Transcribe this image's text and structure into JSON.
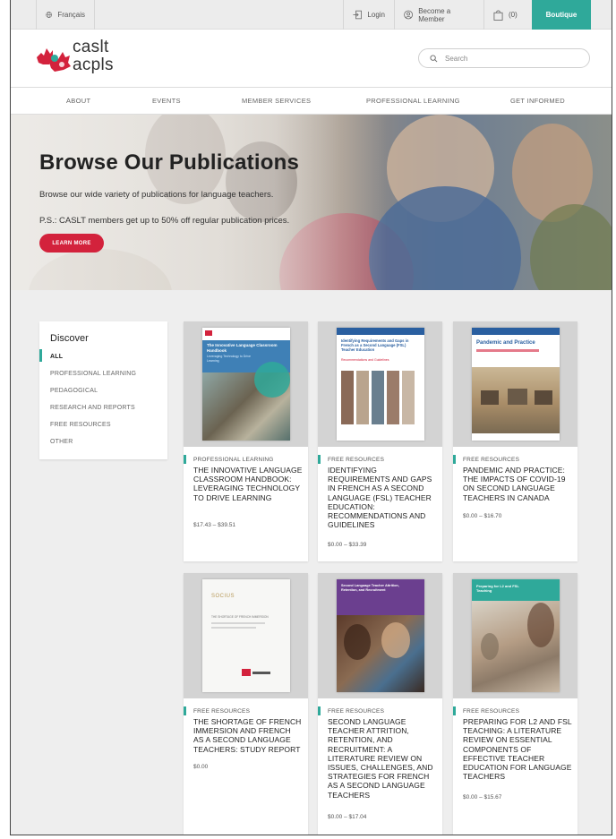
{
  "topbar": {
    "language": "Français",
    "login": "Login",
    "become_member": "Become a Member",
    "cart_count": "(0)",
    "boutique": "Boutique"
  },
  "logo": {
    "line1": "caslt",
    "line2": "acpls"
  },
  "search": {
    "placeholder": "Search"
  },
  "nav": [
    "ABOUT",
    "EVENTS",
    "MEMBER SERVICES",
    "PROFESSIONAL LEARNING",
    "GET INFORMED"
  ],
  "hero": {
    "title": "Browse Our Publications",
    "subtitle": "Browse our wide variety of publications for language teachers.",
    "note": "P.S.: CASLT members get up to 50% off regular publication prices.",
    "cta": "LEARN MORE"
  },
  "sidebar": {
    "heading": "Discover",
    "items": [
      "ALL",
      "PROFESSIONAL LEARNING",
      "PEDAGOGICAL",
      "RESEARCH AND REPORTS",
      "FREE RESOURCES",
      "OTHER"
    ]
  },
  "cards": [
    {
      "category": "PROFESSIONAL LEARNING",
      "title": "THE INNOVATIVE LANGUAGE CLASSROOM HANDBOOK: LEVERAGING TECHNOLOGY TO DRIVE LEARNING",
      "price": "$17.43 – $39.51",
      "cover_title": "The Innovative Language Classroom Handbook",
      "cover_sub": "Leveraging Technology to Drive Learning"
    },
    {
      "category": "FREE RESOURCES",
      "title": "IDENTIFYING REQUIREMENTS AND GAPS IN FRENCH AS A SECOND LANGUAGE (FSL) TEACHER EDUCATION: RECOMMENDATIONS AND GUIDELINES",
      "price": "$0.00 – $33.39",
      "cover_title": "Identifying Requirements and Gaps in French as a Second Language (FSL) Teacher Education",
      "cover_sub": "Recommendations and Guidelines"
    },
    {
      "category": "FREE RESOURCES",
      "title": "PANDEMIC AND PRACTICE: THE IMPACTS OF COVID-19 ON SECOND LANGUAGE TEACHERS IN CANADA",
      "price": "$0.00 – $16.70",
      "cover_title": "Pandemic and Practice",
      "cover_sub": ""
    },
    {
      "category": "FREE RESOURCES",
      "title": "THE SHORTAGE OF FRENCH IMMERSION AND FRENCH AS A SECOND LANGUAGE TEACHERS: STUDY REPORT",
      "price": "$0.00",
      "cover_title": "SOCIUS",
      "cover_sub": "THE SHORTAGE OF FRENCH IMMERSION"
    },
    {
      "category": "FREE RESOURCES",
      "title": "SECOND LANGUAGE TEACHER ATTRITION, RETENTION, AND RECRUITMENT: A LITERATURE REVIEW ON ISSUES, CHALLENGES, AND STRATEGIES FOR FRENCH AS A SECOND LANGUAGE TEACHERS",
      "price": "$0.00 – $17.04",
      "cover_title": "Second Language Teacher Attrition, Retention, and Recruitment",
      "cover_sub": ""
    },
    {
      "category": "FREE RESOURCES",
      "title": "PREPARING FOR L2 AND FSL TEACHING: A LITERATURE REVIEW ON ESSENTIAL COMPONENTS OF EFFECTIVE TEACHER EDUCATION FOR LANGUAGE TEACHERS",
      "price": "$0.00 – $15.67",
      "cover_title": "Preparing for L2 and FSL Teaching",
      "cover_sub": ""
    }
  ],
  "colors": {
    "accent": "#2fa99a",
    "cta": "#d3223c"
  }
}
